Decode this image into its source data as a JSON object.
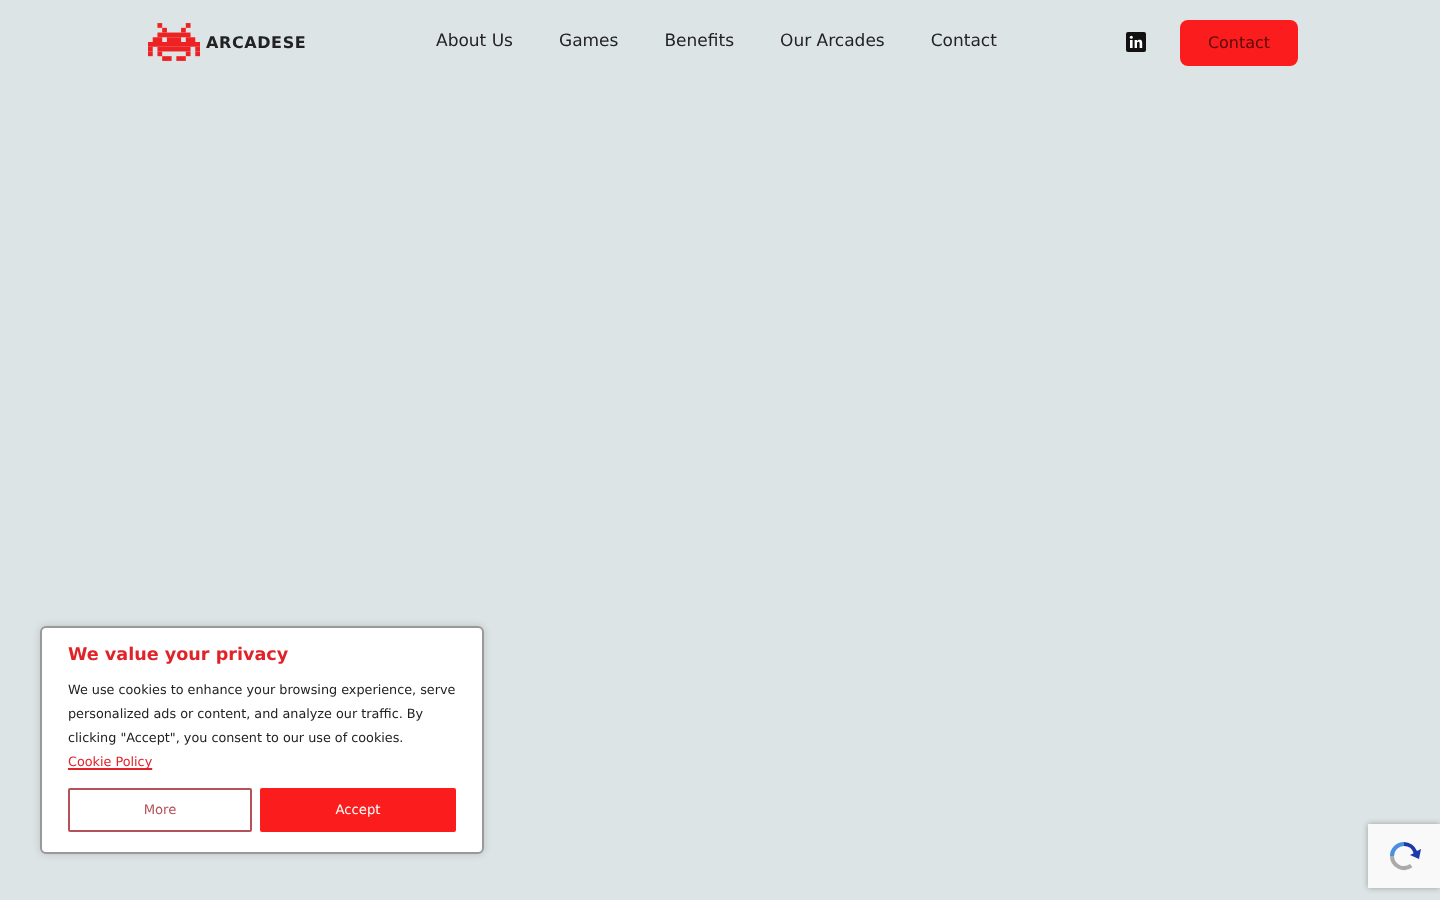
{
  "header": {
    "brand": "ARCADESE",
    "nav": [
      {
        "label": "About Us"
      },
      {
        "label": "Games"
      },
      {
        "label": "Benefits"
      },
      {
        "label": "Our Arcades"
      },
      {
        "label": "Contact"
      }
    ],
    "cta": "Contact"
  },
  "cookie_banner": {
    "title": "We value your privacy",
    "text": "We use cookies to enhance your browsing experience, serve personalized ads or content, and analyze our traffic. By clicking \"Accept\", you consent to our use of cookies.",
    "link": "Cookie Policy",
    "buttons": [
      "More",
      "Accept"
    ]
  }
}
